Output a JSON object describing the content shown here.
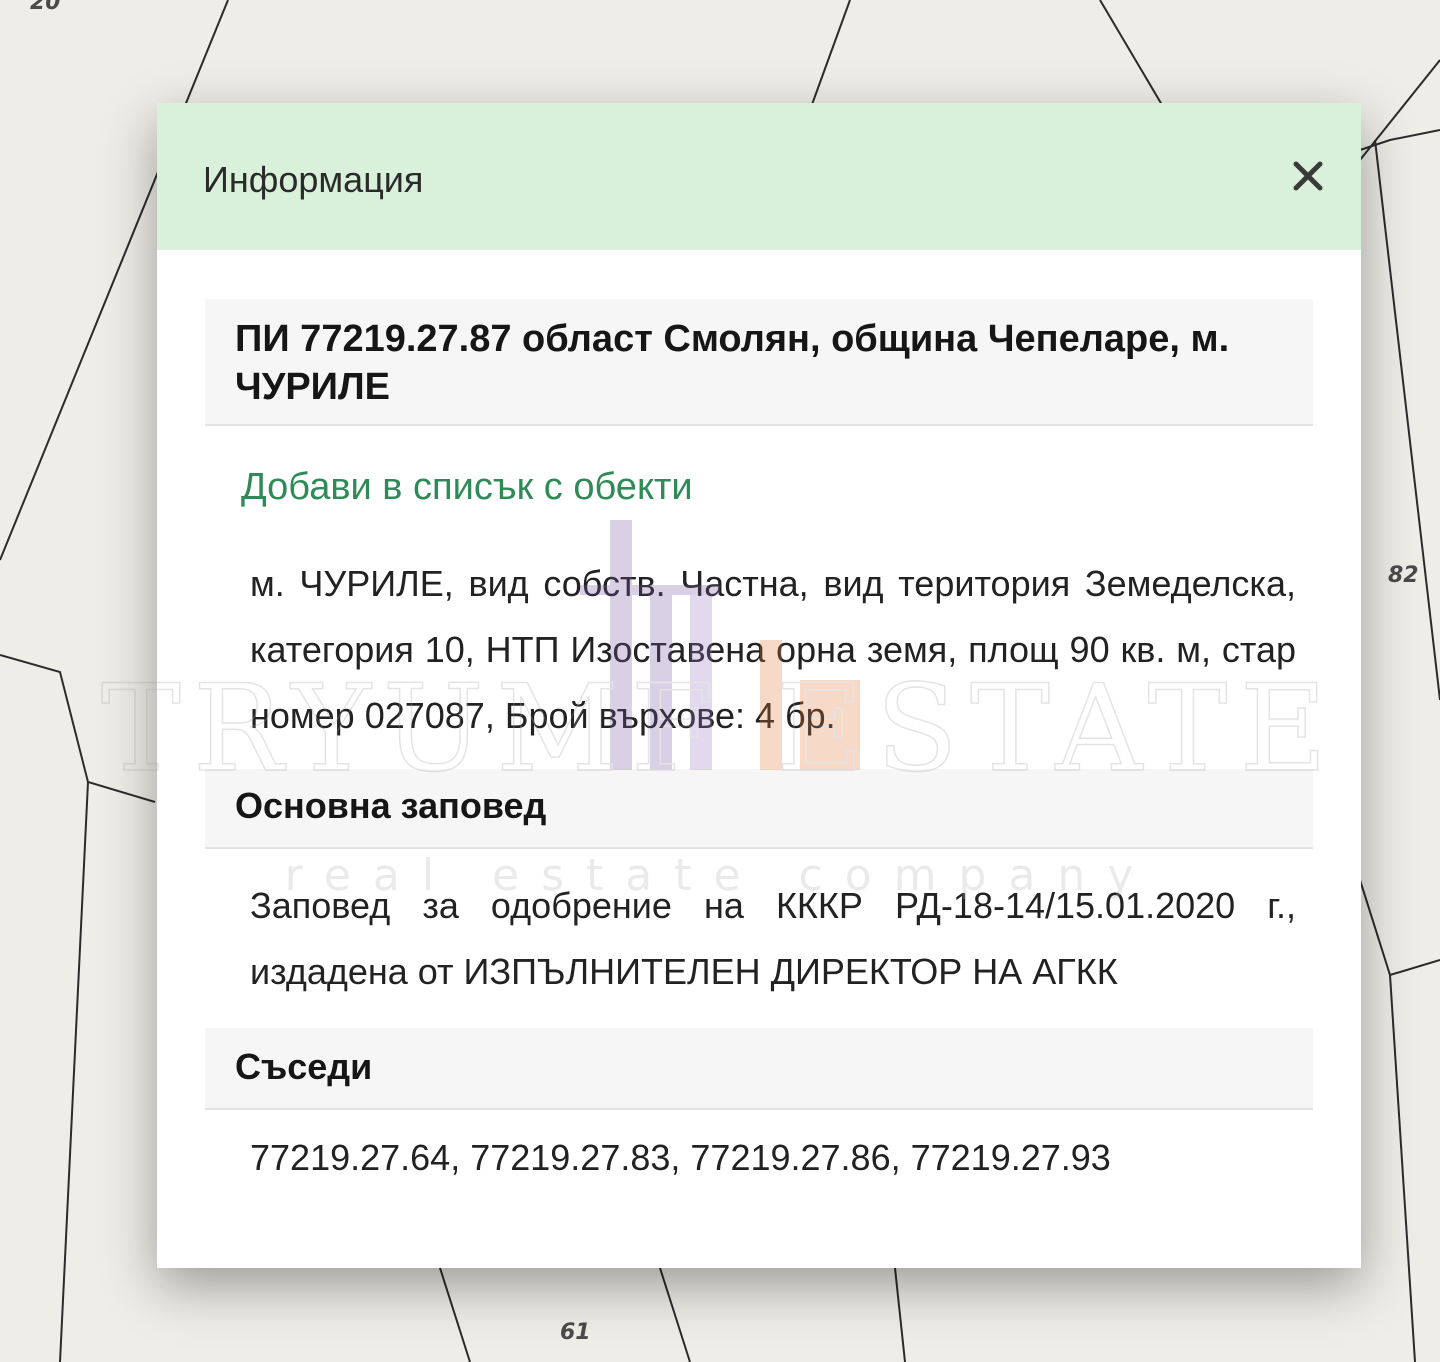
{
  "map": {
    "labels": [
      "20",
      "82",
      "61"
    ]
  },
  "dialog": {
    "title": "Информация",
    "close_icon": "close-icon"
  },
  "parcel": {
    "title": "ПИ 77219.27.87 област Смолян, община Чепеларе, м. ЧУРИЛЕ",
    "add_link": "Добави в списък с обекти",
    "description": "м. ЧУРИЛЕ, вид собств. Частна, вид територия Земеделска, категория 10, НТП Изоставена орна земя, площ 90 кв. м, стар номер 027087, Брой върхове: 4 бр."
  },
  "order": {
    "heading": "Основна заповед",
    "text": "Заповед за одобрение на КККР РД-18-14/15.01.2020 г., издадена от ИЗПЪЛНИТЕЛЕН ДИРЕКТОР НА АГКК"
  },
  "neighbors": {
    "heading": "Съседи",
    "text": "77219.27.64, 77219.27.83, 77219.27.86, 77219.27.93"
  },
  "watermark": {
    "brand": "TRYUMF ESTATE",
    "tagline": "real estate company"
  },
  "colors": {
    "header_bg": "#d9f1da",
    "link": "#2e8b57",
    "map_bg": "#efede7"
  }
}
